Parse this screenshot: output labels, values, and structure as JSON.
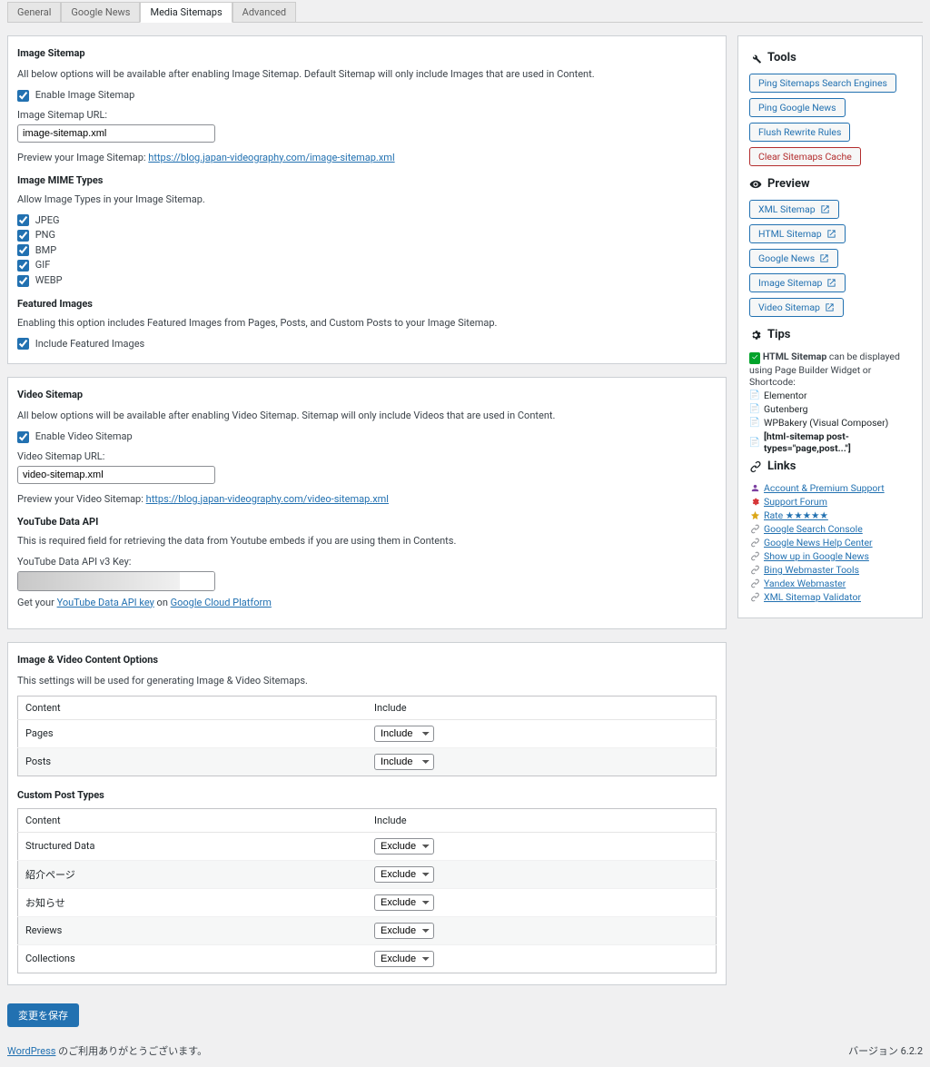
{
  "tabs": [
    "General",
    "Google News",
    "Media Sitemaps",
    "Advanced"
  ],
  "activeTab": 2,
  "imageSitemap": {
    "title": "Image Sitemap",
    "desc": "All below options will be available after enabling Image Sitemap. Default Sitemap will only include Images that are used in Content.",
    "enableLabel": "Enable Image Sitemap",
    "urlLabel": "Image Sitemap URL:",
    "urlValue": "image-sitemap.xml",
    "previewPrefix": "Preview your Image Sitemap: ",
    "previewLink": "https://blog.japan-videography.com/image-sitemap.xml",
    "mimeTitle": "Image MIME Types",
    "mimeDesc": "Allow Image Types in your Image Sitemap.",
    "mimeTypes": [
      "JPEG",
      "PNG",
      "BMP",
      "GIF",
      "WEBP"
    ],
    "featuredTitle": "Featured Images",
    "featuredDesc": "Enabling this option includes Featured Images from Pages, Posts, and Custom Posts to your Image Sitemap.",
    "featuredLabel": "Include Featured Images"
  },
  "videoSitemap": {
    "title": "Video Sitemap",
    "desc": "All below options will be available after enabling Video Sitemap. Sitemap will only include Videos that are used in Content.",
    "enableLabel": "Enable Video Sitemap",
    "urlLabel": "Video Sitemap URL:",
    "urlValue": "video-sitemap.xml",
    "previewPrefix": "Preview your Video Sitemap: ",
    "previewLink": "https://blog.japan-videography.com/video-sitemap.xml",
    "ytTitle": "YouTube Data API",
    "ytDesc": "This is required field for retrieving the data from Youtube embeds if you are using them in Contents.",
    "ytKeyLabel": "YouTube Data API v3 Key:",
    "ytGet1": "Get your ",
    "ytLink1": "YouTube Data API key",
    "ytOn": " on ",
    "ytLink2": "Google Cloud Platform"
  },
  "contentOptions": {
    "title": "Image & Video Content Options",
    "desc": "This settings will be used for generating Image & Video Sitemaps.",
    "thContent": "Content",
    "thInclude": "Include",
    "rows": [
      {
        "name": "Pages",
        "value": "Include"
      },
      {
        "name": "Posts",
        "value": "Include"
      }
    ],
    "cptTitle": "Custom Post Types",
    "cptRows": [
      {
        "name": "Structured Data",
        "value": "Exclude"
      },
      {
        "name": "紹介ページ",
        "value": "Exclude"
      },
      {
        "name": "お知らせ",
        "value": "Exclude"
      },
      {
        "name": "Reviews",
        "value": "Exclude"
      },
      {
        "name": "Collections",
        "value": "Exclude"
      }
    ]
  },
  "selectOptions": [
    "Include",
    "Exclude"
  ],
  "saveLabel": "変更を保存",
  "sidebar": {
    "tools": {
      "title": "Tools",
      "buttons": [
        "Ping Sitemaps Search Engines",
        "Ping Google News",
        "Flush Rewrite Rules",
        "Clear Sitemaps Cache"
      ]
    },
    "preview": {
      "title": "Preview",
      "buttons": [
        "XML Sitemap",
        "HTML Sitemap",
        "Google News",
        "Image Sitemap",
        "Video Sitemap"
      ]
    },
    "tips": {
      "title": "Tips",
      "text1a": "HTML Sitemap",
      "text1b": " can be displayed using Page Builder Widget or Shortcode:",
      "items": [
        "Elementor",
        "Gutenberg",
        "WPBakery (Visual Composer)"
      ],
      "shortcode": "[html-sitemap post-types=\"page,post...\"]"
    },
    "links": {
      "title": "Links",
      "items": [
        {
          "t": "Account & Premium Support",
          "i": "user"
        },
        {
          "t": "Support Forum",
          "i": "cog"
        },
        {
          "t": "Rate ★★★★★",
          "i": "star"
        },
        {
          "t": "Google Search Console",
          "i": "link"
        },
        {
          "t": "Google News Help Center",
          "i": "link"
        },
        {
          "t": "Show up in Google News",
          "i": "link"
        },
        {
          "t": "Bing Webmaster Tools",
          "i": "link"
        },
        {
          "t": "Yandex Webmaster",
          "i": "link"
        },
        {
          "t": "XML Sitemap Validator",
          "i": "link"
        }
      ]
    }
  },
  "footer": {
    "wp": "WordPress",
    "thanks": " のご利用ありがとうございます。",
    "ver": "バージョン 6.2.2"
  }
}
